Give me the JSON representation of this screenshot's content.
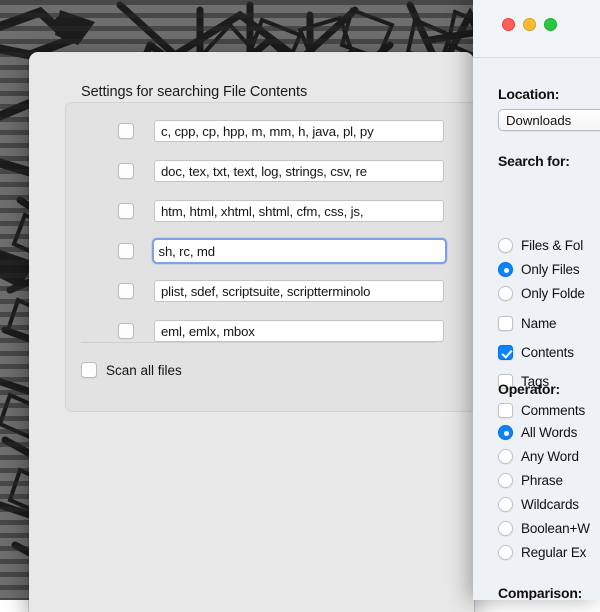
{
  "desktop": {
    "wallpaper_name": "abstract-grayscale-striped-artwork",
    "base_color": "#6e6e6e",
    "ink_color": "#1c1c1c"
  },
  "settings_window": {
    "title": "Settings for searching File Contents",
    "filetype_rows": [
      {
        "checked": false,
        "value": "c, cpp, cp, hpp, m, mm, h, java, pl, py",
        "focused": false
      },
      {
        "checked": false,
        "value": "doc, tex, txt, text, log, strings, csv, re",
        "focused": false
      },
      {
        "checked": false,
        "value": "htm, html, xhtml, shtml, cfm, css, js,",
        "focused": false
      },
      {
        "checked": false,
        "value": "sh, rc, md",
        "focused": true
      },
      {
        "checked": false,
        "value": "plist, sdef, scriptsuite, scriptterminolo",
        "focused": false
      },
      {
        "checked": false,
        "value": "eml, emlx, mbox",
        "focused": false
      }
    ],
    "scan_all": {
      "label": "Scan all files",
      "checked": false
    },
    "focus_ring_color": "#7ea2e2"
  },
  "search_window": {
    "traffic_lights": [
      {
        "name": "close-button",
        "color": "#ff5f57"
      },
      {
        "name": "minimize-button",
        "color": "#febc2e"
      },
      {
        "name": "maximize-button",
        "color": "#28c840"
      }
    ],
    "location": {
      "label": "Location:",
      "selected": "Downloads"
    },
    "search_for": {
      "label": "Search for:",
      "radios": [
        {
          "label": "Files & Fol",
          "selected": false
        },
        {
          "label": "Only Files",
          "selected": true
        },
        {
          "label": "Only Folde",
          "selected": false
        }
      ],
      "checkboxes": [
        {
          "label": "Name",
          "checked": false
        },
        {
          "label": "Contents",
          "checked": true
        },
        {
          "label": "Tags",
          "checked": false
        },
        {
          "label": "Comments",
          "checked": false
        }
      ]
    },
    "operator": {
      "label": "Operator:",
      "options": [
        {
          "label": "All Words",
          "selected": true
        },
        {
          "label": "Any Word",
          "selected": false
        },
        {
          "label": "Phrase",
          "selected": false
        },
        {
          "label": "Wildcards",
          "selected": false
        },
        {
          "label": "Boolean+W",
          "selected": false
        },
        {
          "label": "Regular Ex",
          "selected": false
        }
      ]
    },
    "comparison": {
      "label": "Comparison:"
    },
    "accent_color": "#0a84ff"
  }
}
